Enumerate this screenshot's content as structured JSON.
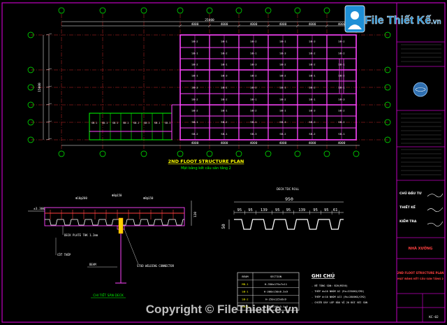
{
  "logo": {
    "brand": "File Thiết Kế",
    "suffix": ".vn"
  },
  "plan": {
    "title": "2ND FLOOT STRUCTURE PLAN",
    "subtitle": "Mặt bằng kết cấu sàn tầng 2",
    "top_total": "25000",
    "left_total": "15000",
    "bay_top": [
      "4000",
      "4000",
      "4000",
      "4000",
      "4000",
      "4000"
    ],
    "bay_bottom": [
      "4000",
      "4000",
      "4000",
      "4000",
      "4000",
      "4000"
    ],
    "beam_labels": [
      "SB-2",
      "SB-1",
      "SB-2",
      "SB-1",
      "SB-3",
      "SB-2"
    ]
  },
  "section": {
    "title": "DECK TDC ROLL",
    "overall": "950",
    "dims": [
      "95",
      "95",
      "139",
      "95",
      "95",
      "139",
      "95",
      "95",
      "61"
    ],
    "height": "50"
  },
  "detail": {
    "level": "±3.300",
    "dim_right": "120",
    "notes": [
      "DECK PLATE THK 1.2mm",
      "CỐT THÉP",
      "BEAM",
      "STUD WELDING CONNECTOR"
    ],
    "rebar_labels": [
      "Φ10@200",
      "Φ8@150",
      "Φ8@150"
    ],
    "title": "CHI TIẾT SÀN DECK"
  },
  "beam_table": {
    "headers": [
      "BEAM",
      "SECTION"
    ],
    "rows": [
      [
        "MB-1",
        "H-350x175x7x11"
      ],
      [
        "SB-1",
        "H-300x150x6.5x9"
      ],
      [
        "SB-2",
        "H-250x125x6x9"
      ],
      [
        "SB-3",
        "H-200x100x5.5x8"
      ]
    ]
  },
  "notes": {
    "title": "GHI CHÚ",
    "items": [
      "- BÊ TÔNG SÀN: B20(M250)",
      "- THÉP d≤10 NHÓM AI (Rs=2250KG/CM2)",
      "- THÉP d>10 NHÓM AII (Rs=2800KG/CM2)",
      "- CHIỀU DÀY LỚP BẢO VỆ 20 ĐỐI VỚI SÀN"
    ]
  },
  "title_block": {
    "label1": "CHỦ ĐẦU TƯ",
    "label2": "THIẾT KẾ",
    "label3": "KIỂM TRA",
    "project": "NHÀ XƯỞNG",
    "sheet_title": "2ND FLOOT STRUCTURE PLAN",
    "sheet_subtitle": "MẶT BẰNG KẾT CẤU SÀN TẦNG 2",
    "sheet_no": "KC-02"
  },
  "watermark": "Copyright © FileThietKe.vn",
  "colors": {
    "bg": "#000000",
    "frame": "#c000c0",
    "beam": "#ff44ff",
    "grid": "#ff3030",
    "text": "#ffffff",
    "label": "#00ff00",
    "dim": "#00c8c8",
    "title": "#ffff00"
  }
}
